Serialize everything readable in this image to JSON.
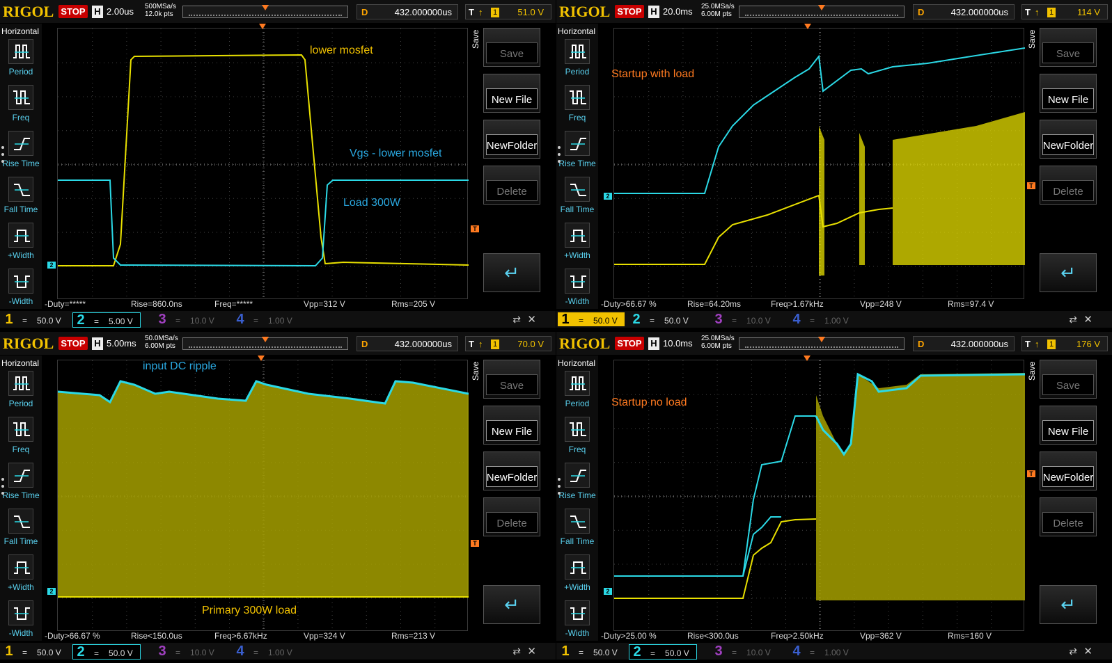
{
  "colors": {
    "yellow": "#f2c200",
    "cyan": "#2bd9e6",
    "orange": "#ff7a20",
    "brand": "#f2c200",
    "stop": "#c80000"
  },
  "panels": [
    {
      "logo": "RIGOL",
      "status": "STOP",
      "h_label": "H",
      "timebase": "2.00us",
      "sample_rate": "500MSa/s",
      "mem_depth": "12.0k pts",
      "d_label": "D",
      "delay": "432.000000us",
      "t_label": "T",
      "trig_level": "51.0 V",
      "left_title": "Horizontal",
      "left_items": [
        "Period",
        "Freq",
        "Rise Time",
        "Fall Time",
        "+Width",
        "-Width"
      ],
      "save_title": "Save",
      "buttons": [
        "Save",
        "New File",
        "NewFolder",
        "Delete"
      ],
      "measurements": [
        "-Duty=*****",
        "Rise=860.0ns",
        "Freq=*****",
        "Vpp=312 V",
        "Rms=205 V"
      ],
      "channels": [
        {
          "n": "1",
          "eq": "=",
          "v": "50.0 V"
        },
        {
          "n": "2",
          "eq": "=",
          "v": "5.00 V"
        },
        {
          "n": "3",
          "eq": "=",
          "v": "10.0 V"
        },
        {
          "n": "4",
          "eq": "=",
          "v": "1.00 V"
        }
      ],
      "active_channel": 2,
      "annotations": [
        {
          "text": "lower mosfet",
          "color": "yellow"
        },
        {
          "text": "Vgs - lower mosfet",
          "color": "blue"
        },
        {
          "text": "Load 300W",
          "color": "blue"
        }
      ]
    },
    {
      "logo": "RIGOL",
      "status": "STOP",
      "h_label": "H",
      "timebase": "20.0ms",
      "sample_rate": "25.0MSa/s",
      "mem_depth": "6.00M pts",
      "d_label": "D",
      "delay": "432.000000us",
      "t_label": "T",
      "trig_level": "114 V",
      "left_title": "Horizontal",
      "left_items": [
        "Period",
        "Freq",
        "Rise Time",
        "Fall Time",
        "+Width",
        "-Width"
      ],
      "save_title": "Save",
      "buttons": [
        "Save",
        "New File",
        "NewFolder",
        "Delete"
      ],
      "measurements": [
        "-Duty>66.67 %",
        "Rise=64.20ms",
        "Freq>1.67kHz",
        "Vpp=248 V",
        "Rms=97.4 V"
      ],
      "channels": [
        {
          "n": "1",
          "eq": "=",
          "v": "50.0 V"
        },
        {
          "n": "2",
          "eq": "=",
          "v": "50.0 V"
        },
        {
          "n": "3",
          "eq": "=",
          "v": "10.0 V"
        },
        {
          "n": "4",
          "eq": "=",
          "v": "1.00 V"
        }
      ],
      "active_channel": 1,
      "annotations": [
        {
          "text": "Startup with load",
          "color": "orange"
        }
      ]
    },
    {
      "logo": "RIGOL",
      "status": "STOP",
      "h_label": "H",
      "timebase": "5.00ms",
      "sample_rate": "50.0MSa/s",
      "mem_depth": "6.00M pts",
      "d_label": "D",
      "delay": "432.000000us",
      "t_label": "T",
      "trig_level": "70.0 V",
      "left_title": "Horizontal",
      "left_items": [
        "Period",
        "Freq",
        "Rise Time",
        "Fall Time",
        "+Width",
        "-Width"
      ],
      "save_title": "Save",
      "buttons": [
        "Save",
        "New File",
        "NewFolder",
        "Delete"
      ],
      "measurements": [
        "-Duty>66.67 %",
        "Rise<150.0us",
        "Freq>6.67kHz",
        "Vpp=324 V",
        "Rms=213 V"
      ],
      "channels": [
        {
          "n": "1",
          "eq": "=",
          "v": "50.0 V"
        },
        {
          "n": "2",
          "eq": "=",
          "v": "50.0 V"
        },
        {
          "n": "3",
          "eq": "=",
          "v": "10.0 V"
        },
        {
          "n": "4",
          "eq": "=",
          "v": "1.00 V"
        }
      ],
      "active_channel": 2,
      "annotations": [
        {
          "text": "input DC ripple",
          "color": "blue"
        },
        {
          "text": "Primary 300W load",
          "color": "yellow"
        }
      ]
    },
    {
      "logo": "RIGOL",
      "status": "STOP",
      "h_label": "H",
      "timebase": "10.0ms",
      "sample_rate": "25.0MSa/s",
      "mem_depth": "6.00M pts",
      "d_label": "D",
      "delay": "432.000000us",
      "t_label": "T",
      "trig_level": "176 V",
      "left_title": "Horizontal",
      "left_items": [
        "Period",
        "Freq",
        "Rise Time",
        "Fall Time",
        "+Width",
        "-Width"
      ],
      "save_title": "Save",
      "buttons": [
        "Save",
        "New File",
        "NewFolder",
        "Delete"
      ],
      "measurements": [
        "-Duty>25.00 %",
        "Rise<300.0us",
        "Freq>2.50kHz",
        "Vpp=362 V",
        "Rms=160 V"
      ],
      "channels": [
        {
          "n": "1",
          "eq": "=",
          "v": "50.0 V"
        },
        {
          "n": "2",
          "eq": "=",
          "v": "50.0 V"
        },
        {
          "n": "3",
          "eq": "=",
          "v": "10.0 V"
        },
        {
          "n": "4",
          "eq": "=",
          "v": "1.00 V"
        }
      ],
      "active_channel": 2,
      "annotations": [
        {
          "text": "Startup no load",
          "color": "orange"
        }
      ]
    }
  ]
}
